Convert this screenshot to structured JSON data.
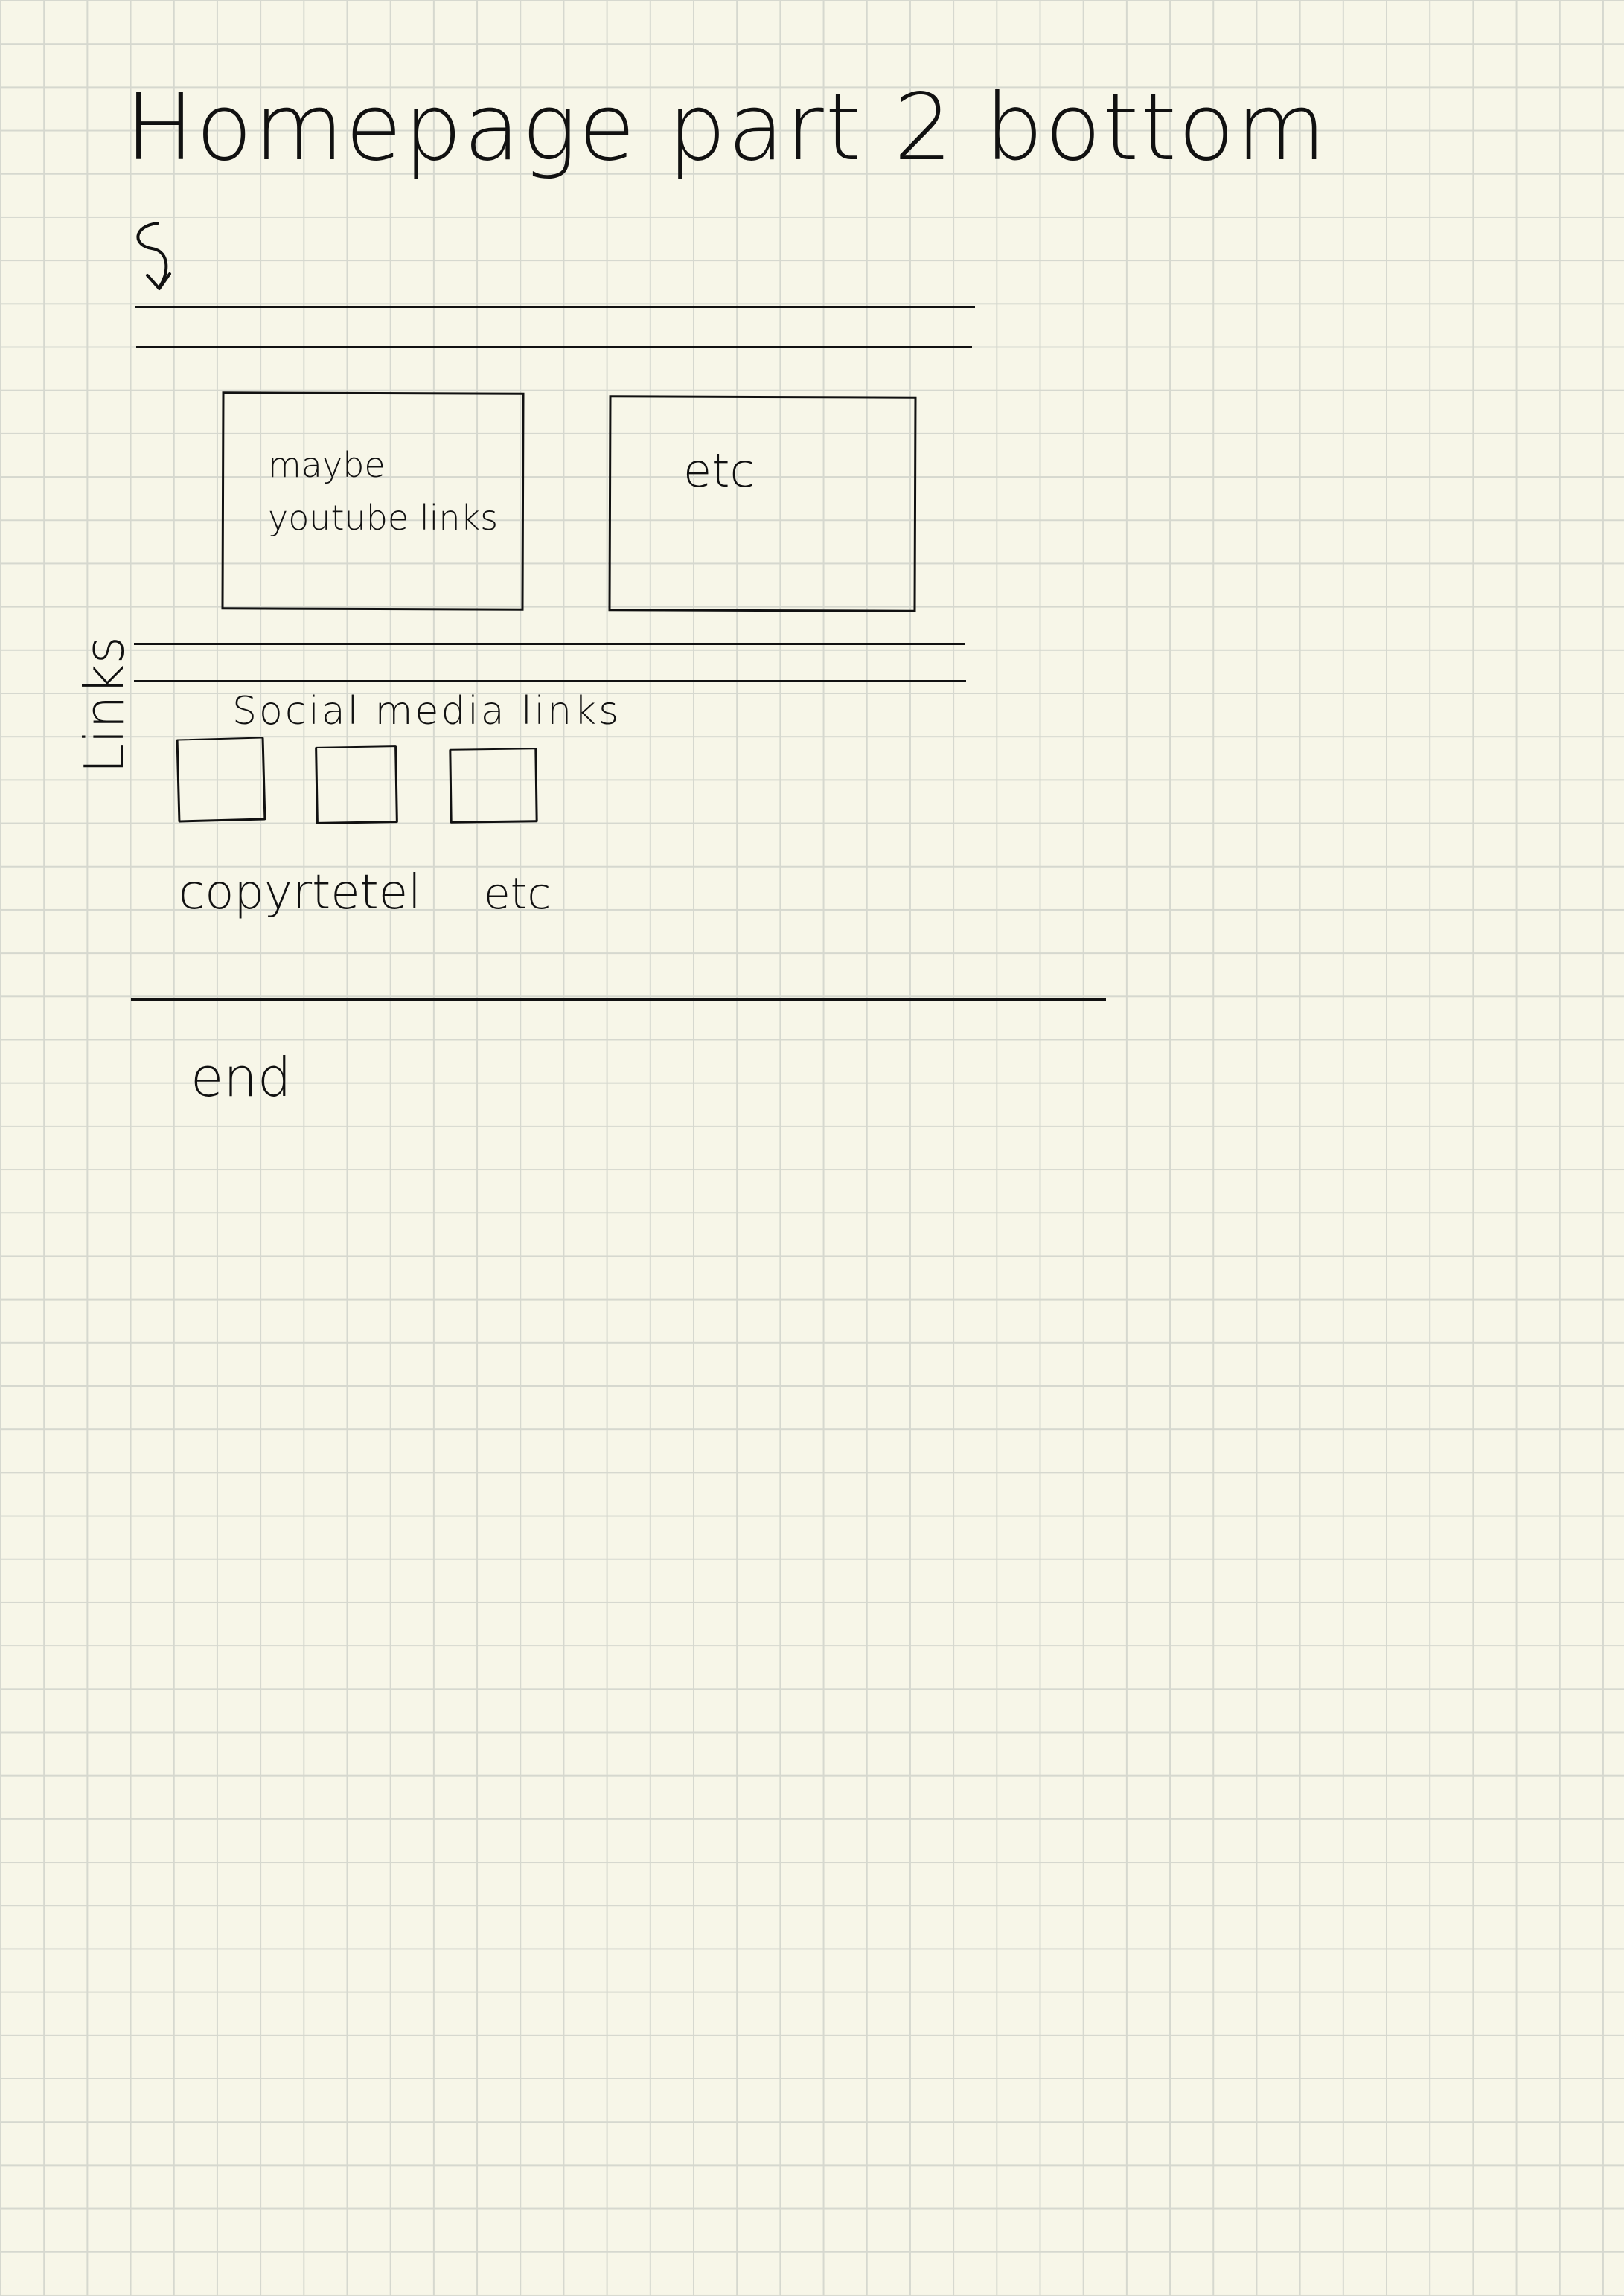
{
  "title": "Homepage part 2 bottom",
  "arrow_icon": "curved-arrow-down-icon",
  "side_label": "Links",
  "boxes": {
    "youtube": "maybe youtube links",
    "etc": "etc"
  },
  "social": {
    "label": "Social media links",
    "icon_placeholders": 3
  },
  "copyright": "copyrtetel",
  "copyright_etc": "etc",
  "end": "end"
}
